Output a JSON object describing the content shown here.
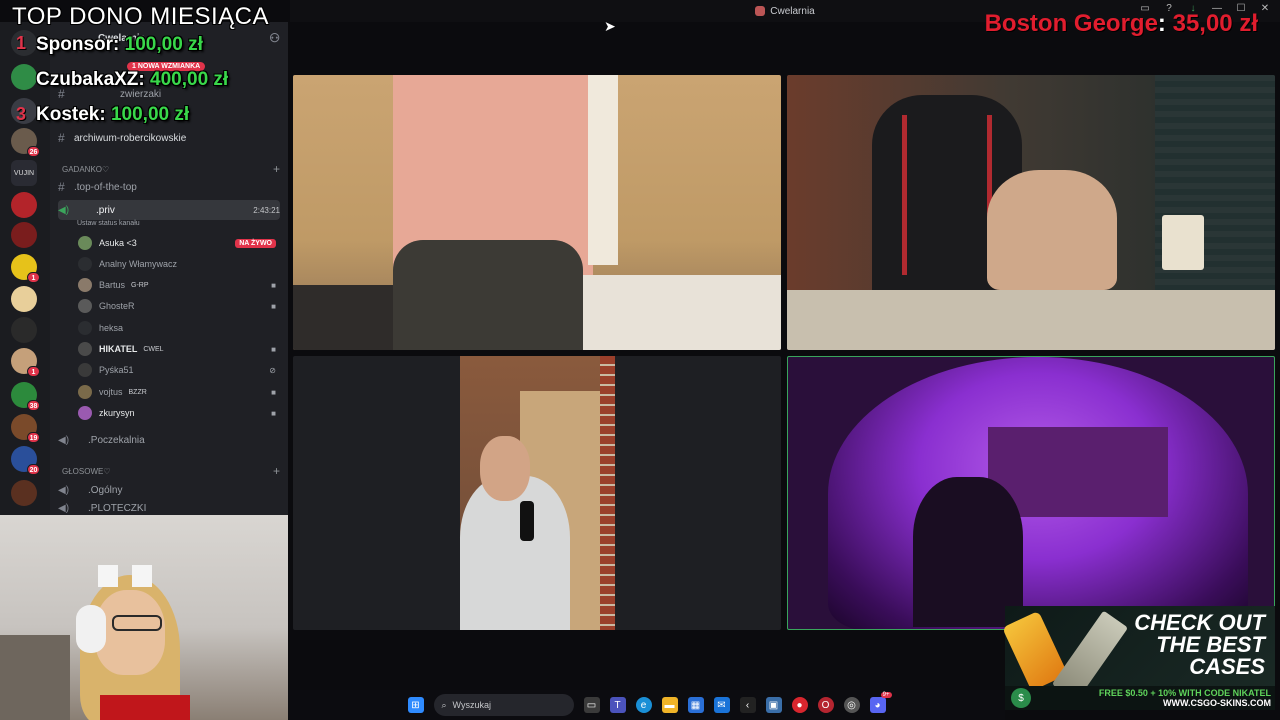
{
  "window": {
    "title": "Cwelarnia"
  },
  "donations": {
    "title": "TOP DONO MIESIĄCA",
    "entries": [
      {
        "rank": "1",
        "name": "Sponsor:",
        "amount": "100,00 zł"
      },
      {
        "rank": "2",
        "name": "CzubakaXZ:",
        "amount": "400,00 zł"
      },
      {
        "rank": "3",
        "name": "Kostek:",
        "amount": "100,00 zł"
      }
    ],
    "latest": {
      "name": "Boston George",
      "colon": ":",
      "amount": "35,00 zł"
    }
  },
  "sidebar": {
    "server_name": "Cwelarnia",
    "mention_pill": "1 NOWA WZMIANKA",
    "channels_top": [
      {
        "label": "zwierzaki"
      },
      {
        "label": "archiwum-robercikowskie"
      }
    ],
    "category_gadanko": "GADANKO♡",
    "channel_top_of_top": ".top-of-the-top",
    "priv": {
      "label": ".priv",
      "time": "2:43:21",
      "status": "Ustaw status kanału"
    },
    "users": [
      {
        "name": "Asuka <3",
        "live": "NA ŻYWO",
        "bright": true
      },
      {
        "name": "Analny Włamywacz"
      },
      {
        "name": "Bartus",
        "tag": "G-RP",
        "cam": true
      },
      {
        "name": "GhosteR",
        "cam": true
      },
      {
        "name": "heksa"
      },
      {
        "name": "HIKATEL",
        "tag": "CWEL",
        "cam": true,
        "bright": true
      },
      {
        "name": "Pyśka51"
      },
      {
        "name": "vojtus",
        "tag": "BZZR",
        "cam": true
      },
      {
        "name": "zkurysyn",
        "cam": true,
        "bright": true
      }
    ],
    "channel_poczekalnia": ".Poczekalnia",
    "category_glosowe": "GŁOSOWE♡",
    "channel_ogolny": ".Ogólny",
    "channel_ploteczki": ".PLOTECZKI",
    "server_badges": [
      "26",
      "1",
      "38",
      "19",
      "20"
    ],
    "server_vujin": "VUJIN"
  },
  "ad": {
    "headline_1": "CHECK OUT",
    "headline_2": "THE BEST",
    "headline_3": "CASES",
    "promo": "FREE $0.50 + 10% WITH CODE NIKATEL",
    "site": "WWW.CSGO-SKINS.COM"
  },
  "taskbar": {
    "search_label": "Wyszukaj",
    "discord_badge": "9+"
  }
}
